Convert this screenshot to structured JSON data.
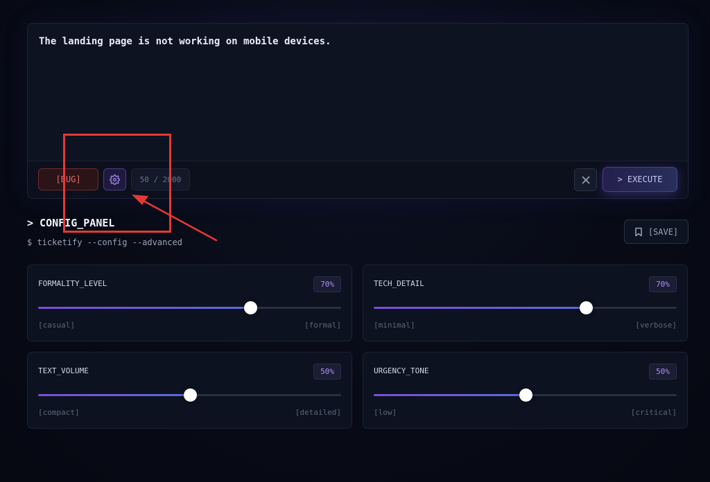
{
  "editor": {
    "text": "The landing page is not working on mobile devices.",
    "tag_label": "[BUG]",
    "counter": "50 / 2000",
    "execute_label": "> EXECUTE"
  },
  "config": {
    "title": "> CONFIG_PANEL",
    "command": "$ ticketify --config --advanced",
    "save_label": "[SAVE]"
  },
  "sliders": [
    {
      "label": "FORMALITY_LEVEL",
      "value": 70,
      "value_text": "70%",
      "min_label": "[casual]",
      "max_label": "[formal]"
    },
    {
      "label": "TECH_DETAIL",
      "value": 70,
      "value_text": "70%",
      "min_label": "[minimal]",
      "max_label": "[verbose]"
    },
    {
      "label": "TEXT_VOLUME",
      "value": 50,
      "value_text": "50%",
      "min_label": "[compact]",
      "max_label": "[detailed]"
    },
    {
      "label": "URGENCY_TONE",
      "value": 50,
      "value_text": "50%",
      "min_label": "[low]",
      "max_label": "[critical]"
    }
  ],
  "colors": {
    "accent": "#7c4ddc",
    "bug_red": "#e86b6b",
    "annotation_red": "#e53935"
  }
}
